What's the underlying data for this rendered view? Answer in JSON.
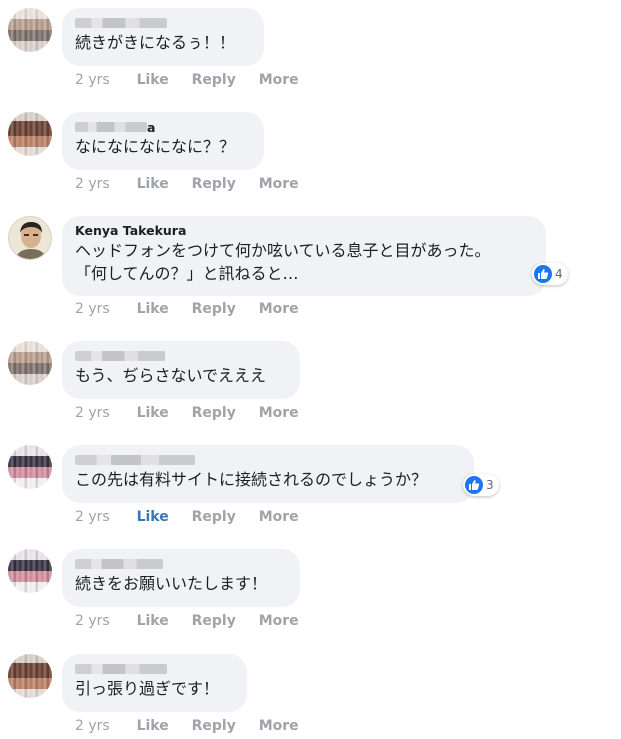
{
  "colors": {
    "bubble": "#f0f2f5",
    "meta": "#a0a4aa",
    "like_active": "#3778b7",
    "reaction_blue": "#1877f2"
  },
  "comments": [
    {
      "author": "",
      "author_blurred": true,
      "text": "続きがきになるぅ！！",
      "time": "2 yrs",
      "like": "Like",
      "reply": "Reply",
      "more": "More",
      "liked": false
    },
    {
      "author": "a",
      "author_blurred": true,
      "text": "なになになになに？？",
      "time": "2 yrs",
      "like": "Like",
      "reply": "Reply",
      "more": "More",
      "liked": false
    },
    {
      "author": "Kenya Takekura",
      "author_blurred": false,
      "text_line1": "ヘッドフォンをつけて何か呟いている息子と目があった。",
      "text_line2": "「何してんの？」と訊ねると…",
      "reaction_icon": "like-icon",
      "reaction_count": "4",
      "time": "2 yrs",
      "like": "Like",
      "reply": "Reply",
      "more": "More",
      "liked": false
    },
    {
      "author": "",
      "author_blurred": true,
      "text": "もう、ぢらさないでえええ",
      "time": "2 yrs",
      "like": "Like",
      "reply": "Reply",
      "more": "More",
      "liked": false
    },
    {
      "author": "",
      "author_blurred": true,
      "text": "この先は有料サイトに接続されるのでしょうか？",
      "reaction_icon": "like-icon",
      "reaction_count": "3",
      "time": "2 yrs",
      "like": "Like",
      "reply": "Reply",
      "more": "More",
      "liked": true
    },
    {
      "author": "",
      "author_blurred": true,
      "text": "続きをお願いいたします！",
      "time": "2 yrs",
      "like": "Like",
      "reply": "Reply",
      "more": "More",
      "liked": false
    },
    {
      "author": "",
      "author_blurred": true,
      "text": "引っ張り過ぎです！",
      "time": "2 yrs",
      "like": "Like",
      "reply": "Reply",
      "more": "More",
      "liked": false
    }
  ]
}
